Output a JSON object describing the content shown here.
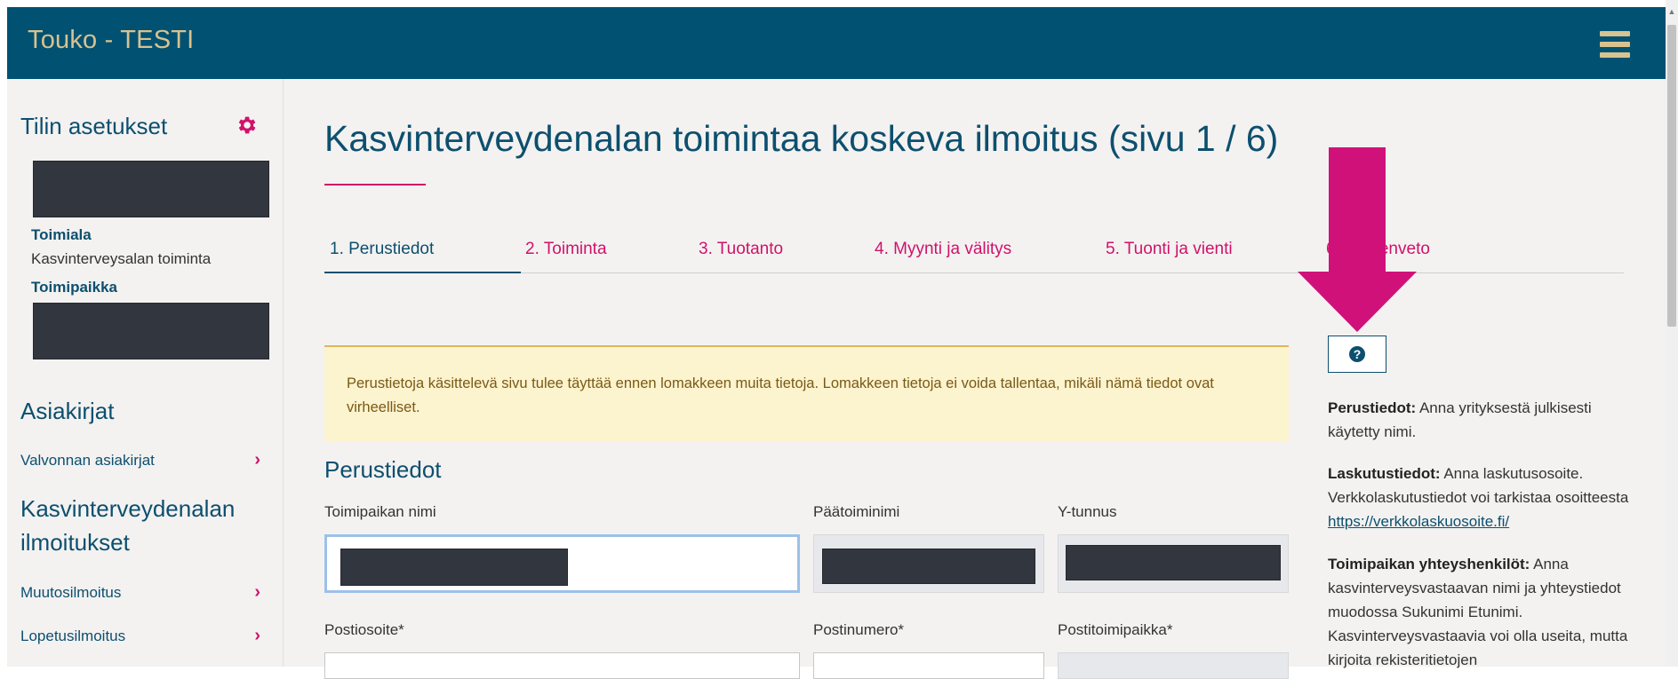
{
  "app": {
    "title": "Touko - TESTI"
  },
  "sidebar": {
    "account_title": "Tilin asetukset",
    "industry_label": "Toimiala",
    "industry_value": "Kasvinterveysalan toiminta",
    "location_label": "Toimipaikka",
    "documents_title": "Asiakirjat",
    "documents_items": [
      {
        "label": "Valvonnan asiakirjat"
      }
    ],
    "notices_title_line1": "Kasvinterveydenalan",
    "notices_title_line2": "ilmoitukset",
    "notices_items": [
      {
        "label": "Muutosilmoitus"
      },
      {
        "label": "Lopetusilmoitus"
      }
    ]
  },
  "main": {
    "title": "Kasvinterveydenalan toimintaa koskeva ilmoitus (sivu 1 / 6)",
    "tabs": [
      {
        "label": "1. Perustiedot",
        "active": true
      },
      {
        "label": "2. Toiminta"
      },
      {
        "label": "3. Tuotanto"
      },
      {
        "label": "4. Myynti ja välitys"
      },
      {
        "label": "5. Tuonti ja vienti"
      },
      {
        "label": "6. Yhteenveto"
      }
    ],
    "notice": "Perustietoja käsittelevä sivu tulee täyttää ennen lomakkeen muita tietoja. Lomakkeen tietoja ei voida tallentaa, mikäli nämä tiedot ovat virheelliset.",
    "section_title": "Perustiedot",
    "fields": {
      "location_name": "Toimipaikan nimi",
      "main_trade_name": "Päätoiminimi",
      "business_id": "Y-tunnus",
      "postal_address": "Postiosoite*",
      "postal_code": "Postinumero*",
      "city": "Postitoimipaikka*"
    }
  },
  "help": {
    "p1_bold": "Perustiedot:",
    "p1_text": " Anna yrityksestä julkisesti käytetty nimi.",
    "p2_bold": "Laskutustiedot:",
    "p2_text": " Anna laskutusosoite. Verkkolaskutustiedot voi tarkistaa osoitteesta ",
    "p2_link": "https://verkkolaskuosoite.fi/",
    "p3_bold": "Toimipaikan yhteyshenkilöt:",
    "p3_text": " Anna kasvinterveysvastaavan nimi ja yhteystiedot muodossa Sukunimi Etunimi. Kasvinterveysvastaavia voi olla useita, mutta kirjoita rekisteritietojen"
  },
  "colors": {
    "header": "#005172",
    "accent": "#d1116a",
    "primary_text": "#0d4f6e",
    "title_gold": "#d8c28f",
    "notice_bg": "#fcf3cf",
    "redaction": "#32363f"
  },
  "icons": [
    "hamburger-menu-icon",
    "gear-icon",
    "chevron-right-icon",
    "question-circle-icon",
    "down-arrow-annotation"
  ]
}
